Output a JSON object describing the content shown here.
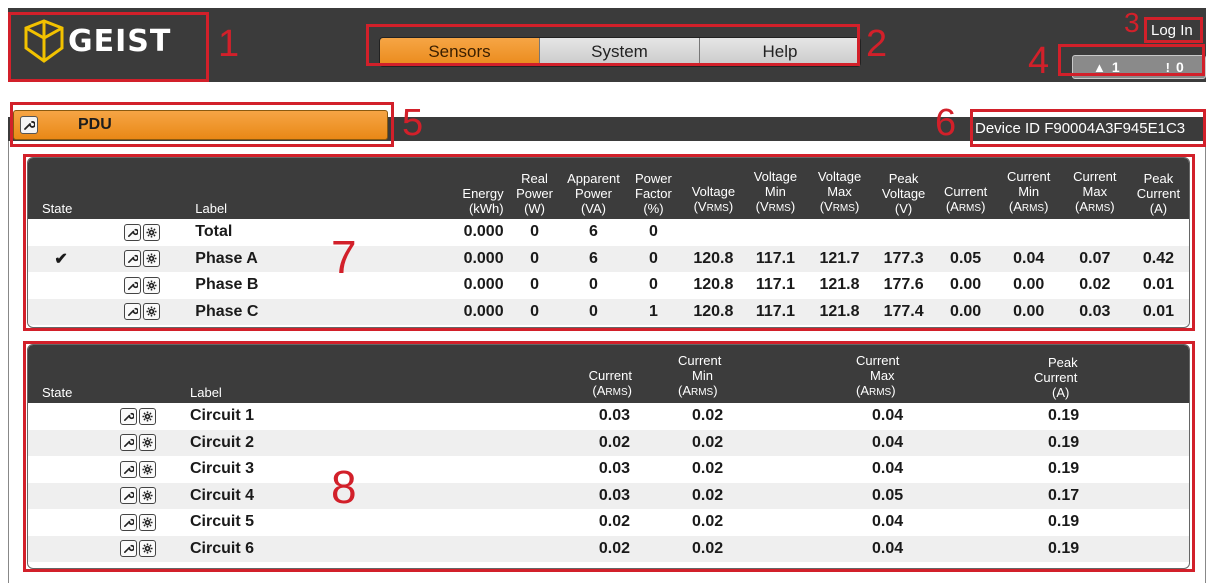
{
  "header": {
    "logo_text": "GEIST",
    "nav": [
      {
        "label": "Sensors",
        "active": true
      },
      {
        "label": "System",
        "active": false
      },
      {
        "label": "Help",
        "active": false
      }
    ],
    "login_label": "Log In",
    "alarms": {
      "warning_count": "1",
      "alert_count": "0"
    }
  },
  "device": {
    "name": "PDU",
    "device_id_label": "Device ID",
    "device_id": "F90004A3F945E1C3"
  },
  "annotations": [
    "1",
    "2",
    "3",
    "4",
    "5",
    "6",
    "7",
    "8"
  ],
  "phase_table": {
    "headers": {
      "state": "State",
      "label": "Label",
      "energy": [
        "Energy",
        "(kWh)"
      ],
      "real_power": [
        "Real",
        "Power",
        "(W)"
      ],
      "apparent_power": [
        "Apparent",
        "Power",
        "(VA)"
      ],
      "power_factor": [
        "Power",
        "Factor",
        "(%)"
      ],
      "voltage": [
        "Voltage",
        "(V",
        "RMS",
        ")"
      ],
      "voltage_min": [
        "Voltage",
        "Min",
        "(V",
        "RMS",
        ")"
      ],
      "voltage_max": [
        "Voltage",
        "Max",
        "(V",
        "RMS",
        ")"
      ],
      "peak_voltage": [
        "Peak",
        "Voltage",
        "(V)"
      ],
      "current": [
        "Current",
        "(A",
        "RMS",
        ")"
      ],
      "current_min": [
        "Current",
        "Min",
        "(A",
        "RMS",
        ")"
      ],
      "current_max": [
        "Current",
        "Max",
        "(A",
        "RMS",
        ")"
      ],
      "peak_current": [
        "Peak",
        "Current",
        "(A)"
      ]
    },
    "rows": [
      {
        "state": "",
        "label": "Total",
        "energy": "0.000",
        "real_power": "0",
        "apparent_power": "6",
        "power_factor": "0",
        "voltage": "",
        "voltage_min": "",
        "voltage_max": "",
        "peak_voltage": "",
        "current": "",
        "current_min": "",
        "current_max": "",
        "peak_current": ""
      },
      {
        "state": "✔",
        "label": "Phase A",
        "energy": "0.000",
        "real_power": "0",
        "apparent_power": "6",
        "power_factor": "0",
        "voltage": "120.8",
        "voltage_min": "117.1",
        "voltage_max": "121.7",
        "peak_voltage": "177.3",
        "current": "0.05",
        "current_min": "0.04",
        "current_max": "0.07",
        "peak_current": "0.42"
      },
      {
        "state": "",
        "label": "Phase B",
        "energy": "0.000",
        "real_power": "0",
        "apparent_power": "0",
        "power_factor": "0",
        "voltage": "120.8",
        "voltage_min": "117.1",
        "voltage_max": "121.8",
        "peak_voltage": "177.6",
        "current": "0.00",
        "current_min": "0.00",
        "current_max": "0.02",
        "peak_current": "0.01"
      },
      {
        "state": "",
        "label": "Phase C",
        "energy": "0.000",
        "real_power": "0",
        "apparent_power": "0",
        "power_factor": "1",
        "voltage": "120.8",
        "voltage_min": "117.1",
        "voltage_max": "121.8",
        "peak_voltage": "177.4",
        "current": "0.00",
        "current_min": "0.00",
        "current_max": "0.03",
        "peak_current": "0.01"
      }
    ]
  },
  "circuit_table": {
    "headers": {
      "state": "State",
      "label": "Label",
      "current": [
        "Current",
        "(A",
        "RMS",
        ")"
      ],
      "current_min": [
        "Current",
        "Min",
        "(A",
        "RMS",
        ")"
      ],
      "current_max": [
        "Current",
        "Max",
        "(A",
        "RMS",
        ")"
      ],
      "peak_current": [
        "Peak",
        "Current",
        "(A)"
      ]
    },
    "rows": [
      {
        "label": "Circuit 1",
        "current": "0.03",
        "current_min": "0.02",
        "current_max": "0.04",
        "peak_current": "0.19"
      },
      {
        "label": "Circuit 2",
        "current": "0.02",
        "current_min": "0.02",
        "current_max": "0.04",
        "peak_current": "0.19"
      },
      {
        "label": "Circuit 3",
        "current": "0.03",
        "current_min": "0.02",
        "current_max": "0.04",
        "peak_current": "0.19"
      },
      {
        "label": "Circuit 4",
        "current": "0.03",
        "current_min": "0.02",
        "current_max": "0.05",
        "peak_current": "0.17"
      },
      {
        "label": "Circuit 5",
        "current": "0.02",
        "current_min": "0.02",
        "current_max": "0.04",
        "peak_current": "0.19"
      },
      {
        "label": "Circuit 6",
        "current": "0.02",
        "current_min": "0.02",
        "current_max": "0.04",
        "peak_current": "0.19"
      }
    ]
  },
  "colors": {
    "accent": "#ea8a1b",
    "header_bg": "#3b3b3b",
    "annotation": "#d2202a",
    "logo_yellow": "#f2c200"
  },
  "icons": {
    "wrench": "wrench-icon",
    "gear": "gear-icon",
    "warning": "warning-icon",
    "alert": "alert-icon",
    "check": "check-icon"
  }
}
